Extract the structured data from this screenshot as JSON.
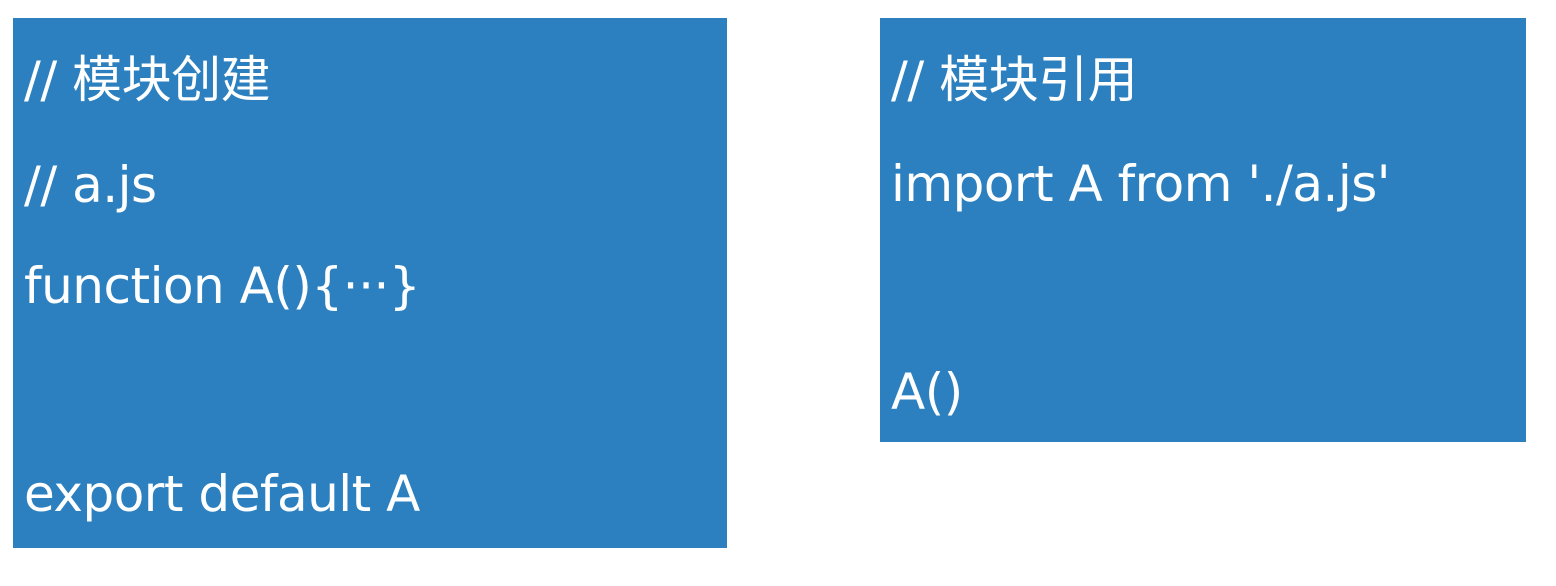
{
  "module_create": {
    "lines": [
      "// 模块创建",
      "// a.js",
      "function A(){···}",
      "",
      "export default A"
    ]
  },
  "module_import": {
    "lines": [
      "// 模块引用",
      "import A from './a.js'",
      "",
      "A()"
    ]
  },
  "colors": {
    "panel_background": "#2c80bf",
    "text": "#ffffff",
    "page_background": "#ffffff"
  }
}
